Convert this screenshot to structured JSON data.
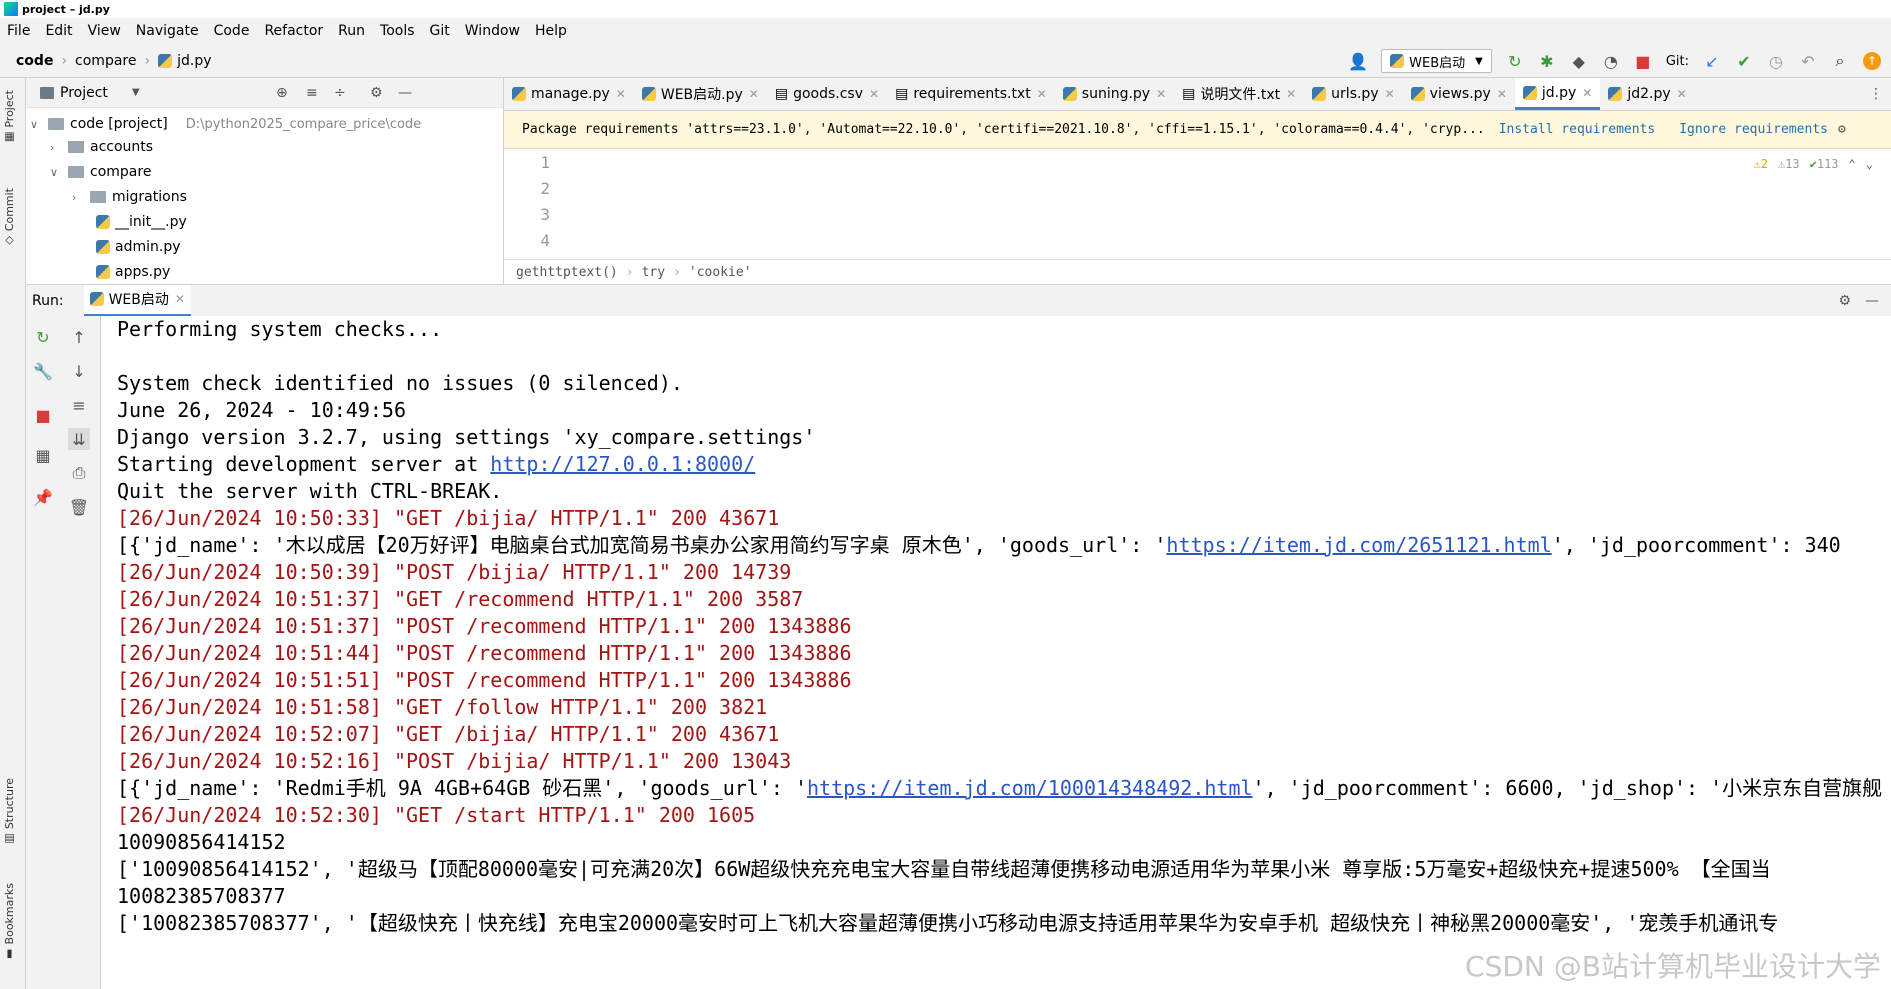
{
  "window": {
    "title": "project – jd.py"
  },
  "menu": [
    "File",
    "Edit",
    "View",
    "Navigate",
    "Code",
    "Refactor",
    "Run",
    "Tools",
    "Git",
    "Window",
    "Help"
  ],
  "breadcrumb": {
    "root": "code",
    "folder": "compare",
    "file": "jd.py"
  },
  "toolbar": {
    "run_config": "WEB启动",
    "git_label": "Git:"
  },
  "project_panel": {
    "title": "Project",
    "root_label": "code [project]",
    "root_path": "D:\\python2025_compare_price\\code",
    "items": [
      "accounts",
      "compare",
      "migrations",
      "__init__.py",
      "admin.py",
      "apps.py"
    ]
  },
  "editor_tabs": [
    {
      "label": "manage.py"
    },
    {
      "label": "WEB启动.py"
    },
    {
      "label": "goods.csv"
    },
    {
      "label": "requirements.txt"
    },
    {
      "label": "suning.py"
    },
    {
      "label": "说明文件.txt"
    },
    {
      "label": "urls.py"
    },
    {
      "label": "views.py"
    },
    {
      "label": "jd.py"
    },
    {
      "label": "jd2.py"
    }
  ],
  "banner": {
    "text": "Package requirements 'attrs==23.1.0', 'Automat==22.10.0', 'certifi==2021.10.8', 'cffi==1.15.1', 'colorama==0.4.4', 'cryp...",
    "install": "Install requirements",
    "ignore": "Ignore requirements"
  },
  "editor": {
    "line_numbers": [
      "1",
      "2",
      "3",
      "4"
    ],
    "inspections": {
      "warnings": "2",
      "weak": "13",
      "ok": "113"
    },
    "breadcrumb": [
      "gethttptext()",
      "try",
      "'cookie'"
    ]
  },
  "run_panel": {
    "label": "Run:",
    "tab": "WEB启动"
  },
  "console": {
    "lines": [
      {
        "text": "Performing system checks...",
        "red": false
      },
      {
        "text": "",
        "red": false
      },
      {
        "text": "System check identified no issues (0 silenced).",
        "red": false
      },
      {
        "text": "June 26, 2024 - 10:49:56",
        "red": false
      },
      {
        "text": "Django version 3.2.7, using settings 'xy_compare.settings'",
        "red": false
      },
      {
        "pre": "Starting development server at ",
        "link": "http://127.0.0.1:8000/",
        "post": "",
        "red": false
      },
      {
        "text": "Quit the server with CTRL-BREAK.",
        "red": false
      },
      {
        "text": "[26/Jun/2024 10:50:33] \"GET /bijia/ HTTP/1.1\" 200 43671",
        "red": true
      },
      {
        "pre": "[{'jd_name': '木以成居【20万好评】电脑桌台式加宽简易书桌办公家用简约写字桌 原木色', 'goods_url': '",
        "link": "https://item.jd.com/2651121.html",
        "post": "', 'jd_poorcomment': 340",
        "red": false
      },
      {
        "text": "[26/Jun/2024 10:50:39] \"POST /bijia/ HTTP/1.1\" 200 14739",
        "red": true
      },
      {
        "text": "[26/Jun/2024 10:51:37] \"GET /recommend HTTP/1.1\" 200 3587",
        "red": true
      },
      {
        "text": "[26/Jun/2024 10:51:37] \"POST /recommend HTTP/1.1\" 200 1343886",
        "red": true
      },
      {
        "text": "[26/Jun/2024 10:51:44] \"POST /recommend HTTP/1.1\" 200 1343886",
        "red": true
      },
      {
        "text": "[26/Jun/2024 10:51:51] \"POST /recommend HTTP/1.1\" 200 1343886",
        "red": true
      },
      {
        "text": "[26/Jun/2024 10:51:58] \"GET /follow HTTP/1.1\" 200 3821",
        "red": true
      },
      {
        "text": "[26/Jun/2024 10:52:07] \"GET /bijia/ HTTP/1.1\" 200 43671",
        "red": true
      },
      {
        "text": "[26/Jun/2024 10:52:16] \"POST /bijia/ HTTP/1.1\" 200 13043",
        "red": true
      },
      {
        "pre": "[{'jd_name': 'Redmi手机 9A 4GB+64GB 砂石黑', 'goods_url': '",
        "link": "https://item.jd.com/100014348492.html",
        "post": "', 'jd_poorcomment': 6600, 'jd_shop': '小米京东自营旗舰",
        "red": false
      },
      {
        "text": "[26/Jun/2024 10:52:30] \"GET /start HTTP/1.1\" 200 1605",
        "red": true
      },
      {
        "text": "10090856414152",
        "red": false
      },
      {
        "text": "['10090856414152', '超级马【顶配80000毫安|可充满20次】66W超级快充充电宝大容量自带线超薄便携移动电源适用华为苹果小米 尊享版:5万毫安+超级快充+提速500% 【全国当",
        "red": false
      },
      {
        "text": "10082385708377",
        "red": false
      },
      {
        "text": "['10082385708377', '【超级快充丨快充线】充电宝20000毫安时可上飞机大容量超薄便携小巧移动电源支持适用苹果华为安卓手机 超级快充丨神秘黑20000毫安', '宠羡手机通讯专",
        "red": false
      }
    ]
  },
  "watermark": "CSDN @B站计算机毕业设计大学"
}
